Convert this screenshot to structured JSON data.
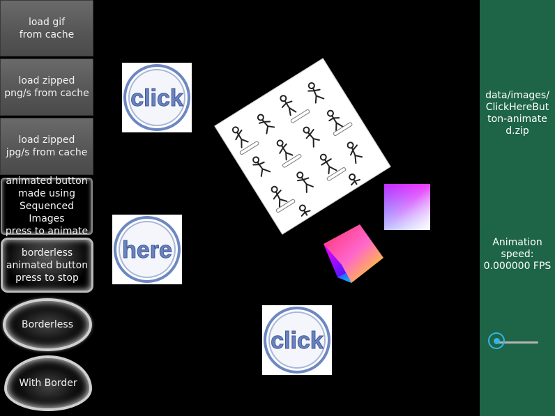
{
  "sidebar": {
    "buttons": [
      {
        "label": "load gif\nfrom cache"
      },
      {
        "label": "load zipped\npng/s from cache"
      },
      {
        "label": "load zipped\njpg/s from cache"
      },
      {
        "label": "animated button\nmade using\nSequenced Images\npress to animate"
      },
      {
        "label": "borderless\nanimated button\npress to stop"
      },
      {
        "label": "Borderless"
      },
      {
        "label": "With Border"
      }
    ]
  },
  "images": {
    "click_top": "click",
    "here": "here",
    "click_bottom": "click"
  },
  "right_panel": {
    "source_path": "data/images/ClickHereButton-animated.zip",
    "animation_speed_label": "Animation speed:",
    "animation_speed_value": "0.000000 FPS",
    "slider_value": 0,
    "background": "#1e6447",
    "accent": "#33b5e5"
  },
  "icons": {
    "stick_figures": "stick-figure-sprite",
    "cube": "color-cube"
  }
}
